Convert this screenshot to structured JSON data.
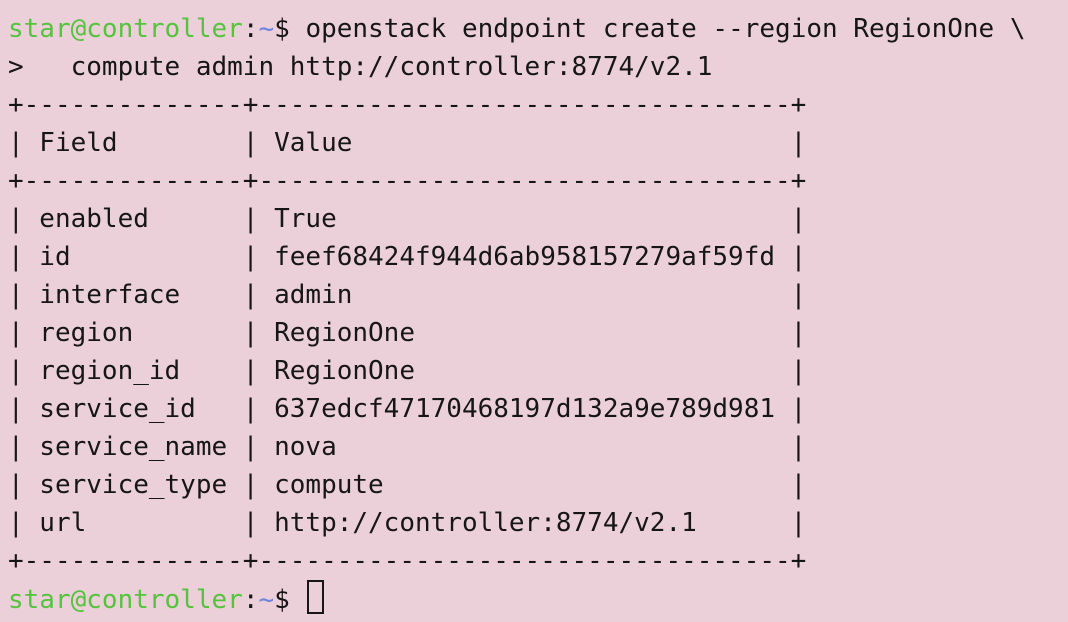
{
  "colors": {
    "background": "#ecd0d9",
    "text": "#161616",
    "prompt_user_host": "#55c33d",
    "prompt_path": "#6b84e0"
  },
  "prompt": {
    "user_host": "star@controller",
    "sep": ":",
    "path": "~",
    "symbol": "$ "
  },
  "command": {
    "line1": "openstack endpoint create --region RegionOne \\",
    "line2": ">   compute admin http://controller:8774/v2.1"
  },
  "table": {
    "border_top": "+--------------+----------------------------------+",
    "header": "| Field        | Value                            |",
    "border_mid": "+--------------+----------------------------------+",
    "rows": [
      "| enabled      | True                             |",
      "| id           | feef68424f944d6ab958157279af59fd |",
      "| interface    | admin                            |",
      "| region       | RegionOne                        |",
      "| region_id    | RegionOne                        |",
      "| service_id   | 637edcf47170468197d132a9e789d981 |",
      "| service_name | nova                             |",
      "| service_type | compute                          |",
      "| url          | http://controller:8774/v2.1      |"
    ],
    "border_bottom": "+--------------+----------------------------------+"
  },
  "final_prompt": {
    "user_host": "star@controller",
    "sep": ":",
    "path": "~",
    "symbol": "$ "
  }
}
